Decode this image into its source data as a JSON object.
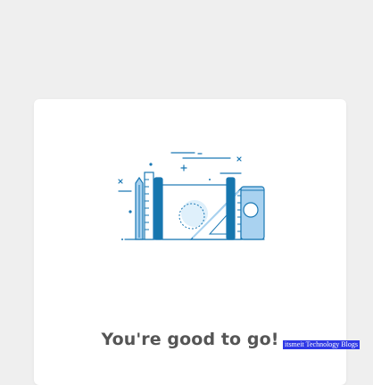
{
  "message": {
    "headline": "You're good to go!"
  },
  "illustration": {
    "icon": "stationery-books-ruler-illustration",
    "colors": {
      "outline": "#1a78b4",
      "dark": "#1676ad",
      "light": "#a9d2f0",
      "pale": "#dff0fb"
    }
  },
  "watermark": {
    "text": "itsmeit Technology Blogs"
  },
  "colors": {
    "background": "#efefef",
    "card": "#ffffff",
    "headline": "#555555",
    "watermark_bg": "#2f39e6"
  }
}
